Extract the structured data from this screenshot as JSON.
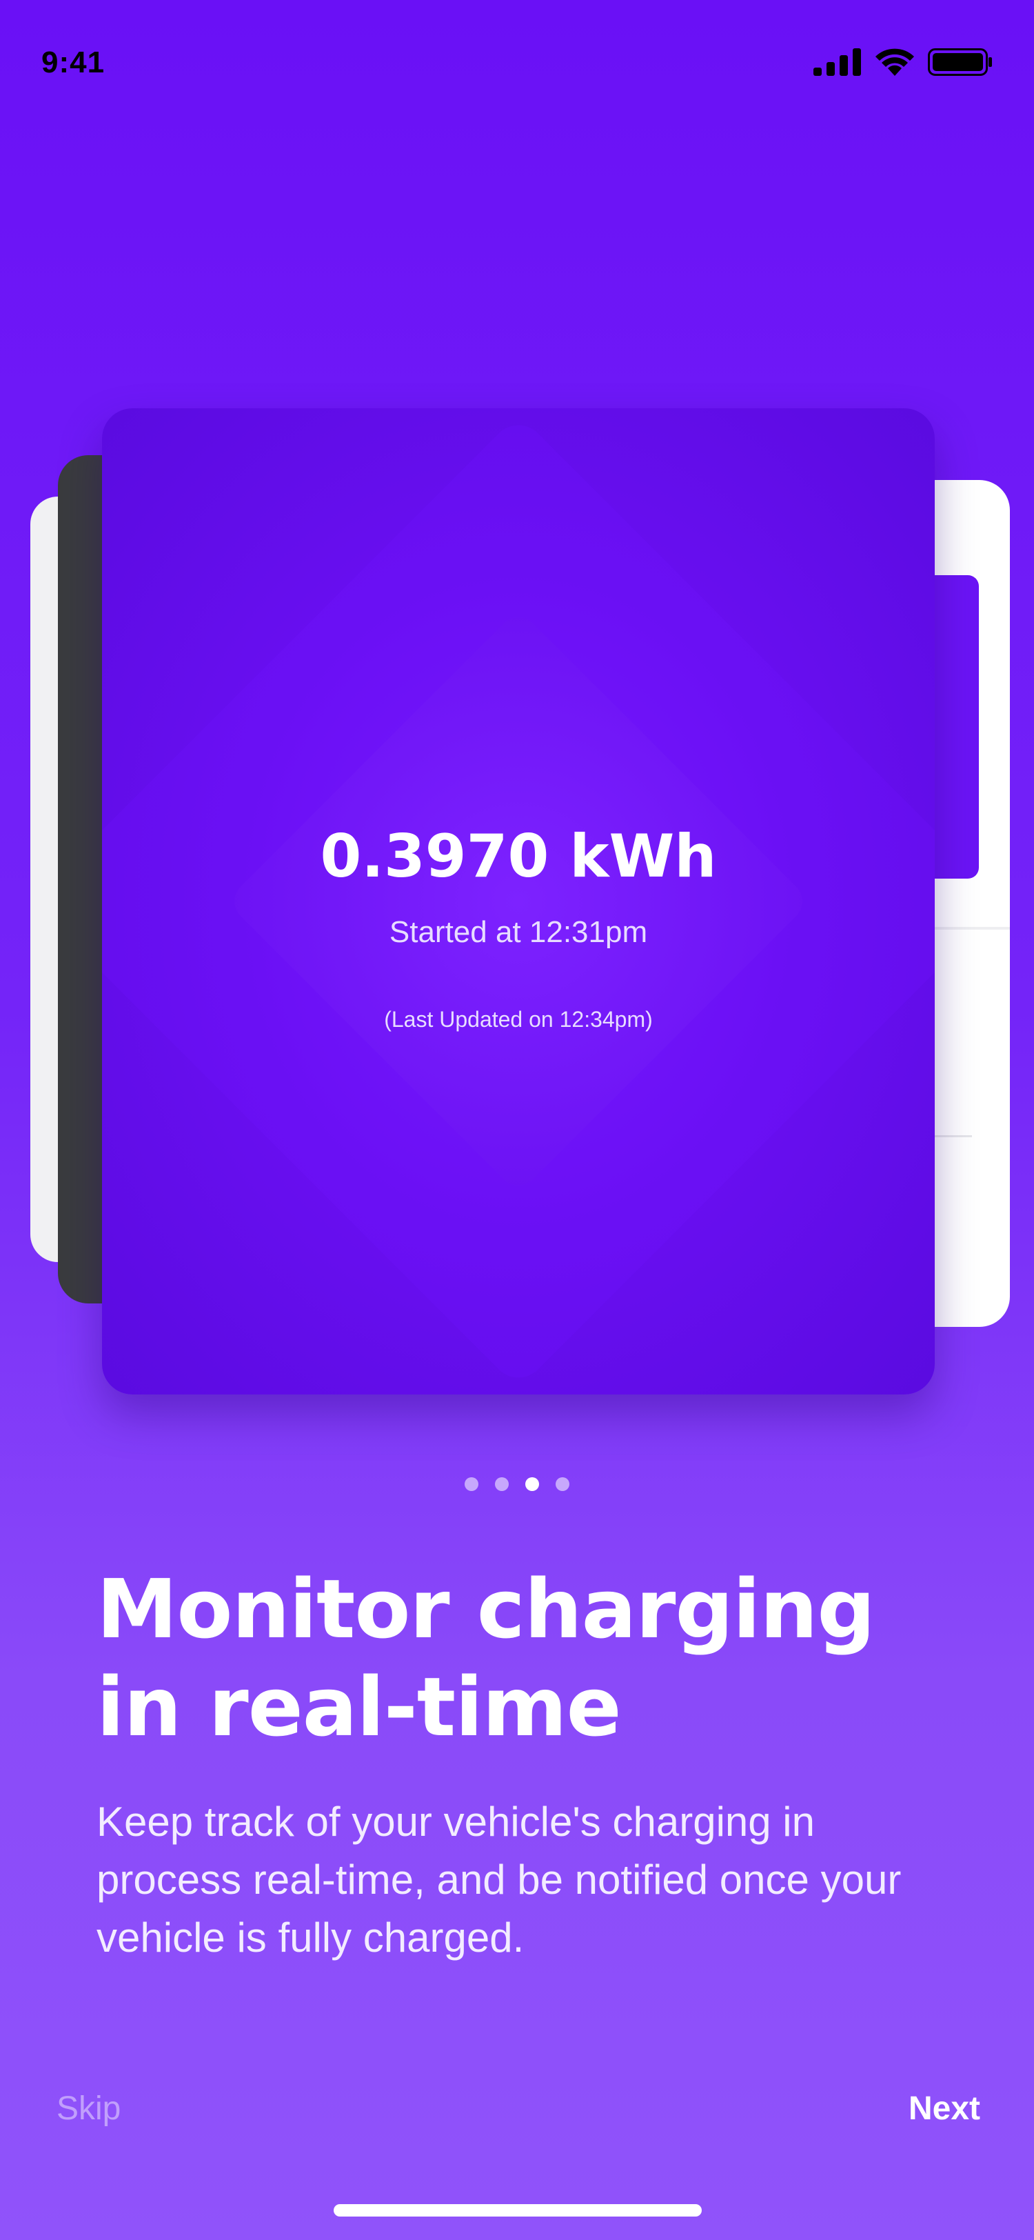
{
  "status_bar": {
    "time": "9:41",
    "icons": [
      "cellular-signal-icon",
      "wifi-icon",
      "battery-icon"
    ]
  },
  "card": {
    "energy": "0.3970 kWh",
    "started": "Started at 12:31pm",
    "updated": "(Last Updated on 12:34pm)"
  },
  "pagination": {
    "count": 4,
    "active_index": 2
  },
  "onboarding": {
    "title": "Monitor charging in real-time",
    "description": "Keep track of your vehicle's charging in process real-time, and be notified once your vehicle is fully charged."
  },
  "controls": {
    "skip_label": "Skip",
    "next_label": "Next"
  },
  "colors": {
    "primary": "#6a10f6",
    "accent_light": "#9053fa",
    "text": "#ffffff"
  }
}
